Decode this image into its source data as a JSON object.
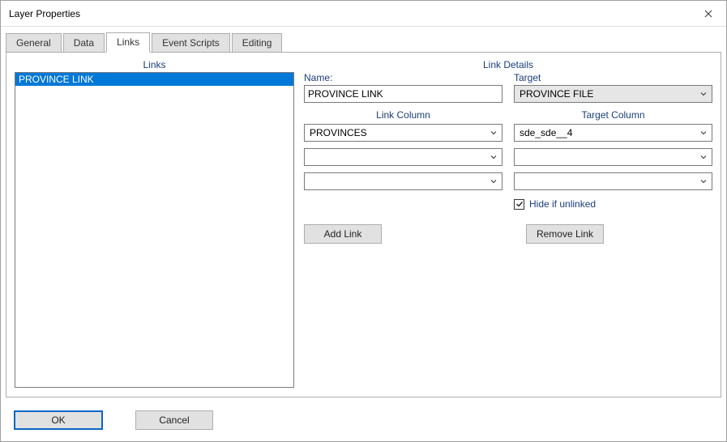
{
  "window": {
    "title": "Layer Properties"
  },
  "tabs": [
    {
      "label": "General",
      "active": false
    },
    {
      "label": "Data",
      "active": false
    },
    {
      "label": "Links",
      "active": true
    },
    {
      "label": "Event Scripts",
      "active": false
    },
    {
      "label": "Editing",
      "active": false
    }
  ],
  "leftPane": {
    "heading": "Links",
    "items": [
      {
        "label": "PROVINCE LINK",
        "selected": true
      }
    ]
  },
  "details": {
    "heading": "Link Details",
    "nameLabel": "Name:",
    "nameValue": "PROVINCE LINK",
    "targetLabel": "Target",
    "targetValue": "PROVINCE FILE",
    "linkColumnLabel": "Link Column",
    "targetColumnLabel": "Target Column",
    "linkColumns": [
      "PROVINCES",
      "",
      ""
    ],
    "targetColumns": [
      "sde_sde__4",
      "",
      ""
    ],
    "hideIfUnlinkedLabel": "Hide if unlinked",
    "hideIfUnlinkedChecked": true,
    "addLinkLabel": "Add Link",
    "removeLinkLabel": "Remove Link"
  },
  "footer": {
    "okLabel": "OK",
    "cancelLabel": "Cancel"
  }
}
